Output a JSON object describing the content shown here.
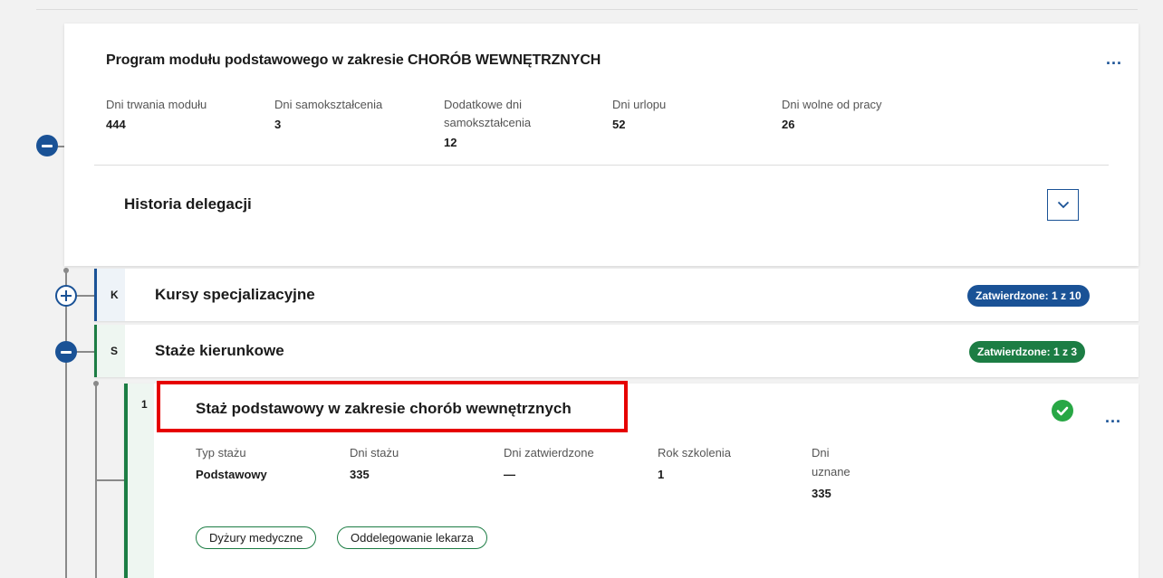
{
  "module": {
    "title": "Program modułu podstawowego w zakresie CHORÓB WEWNĘTRZNYCH",
    "stats": [
      {
        "label": "Dni trwania modułu",
        "value": "444"
      },
      {
        "label": "Dni samokształcenia",
        "value": "3"
      },
      {
        "label": "Dodatkowe dni samokształcenia",
        "value": "12"
      },
      {
        "label": "Dni urlopu",
        "value": "52"
      },
      {
        "label": "Dni wolne od pracy",
        "value": "26"
      }
    ],
    "more_label": "...",
    "history_title": "Historia delegacji"
  },
  "rows": [
    {
      "code": "K",
      "label": "Kursy specjalizacyjne",
      "badge": "Zatwierdzone: 1 z 10",
      "color": "#1a5296"
    },
    {
      "code": "S",
      "label": "Staże kierunkowe",
      "badge": "Zatwierdzone: 1 z 3",
      "color": "#1c7d44"
    }
  ],
  "stage": {
    "index": "1",
    "title": "Staż podstawowy w zakresie chorób wewnętrznych",
    "more_label": "...",
    "stats": [
      {
        "label": "Typ stażu",
        "value": "Podstawowy"
      },
      {
        "label": "Dni stażu",
        "value": "335"
      },
      {
        "label": "Dni zatwierdzone",
        "value": "—"
      },
      {
        "label": "Rok szkolenia",
        "value": "1"
      },
      {
        "label": "Dni uznane",
        "value": "335"
      }
    ],
    "chips": [
      "Dyżury medyczne",
      "Oddelegowanie lekarza"
    ],
    "status": "approved"
  }
}
